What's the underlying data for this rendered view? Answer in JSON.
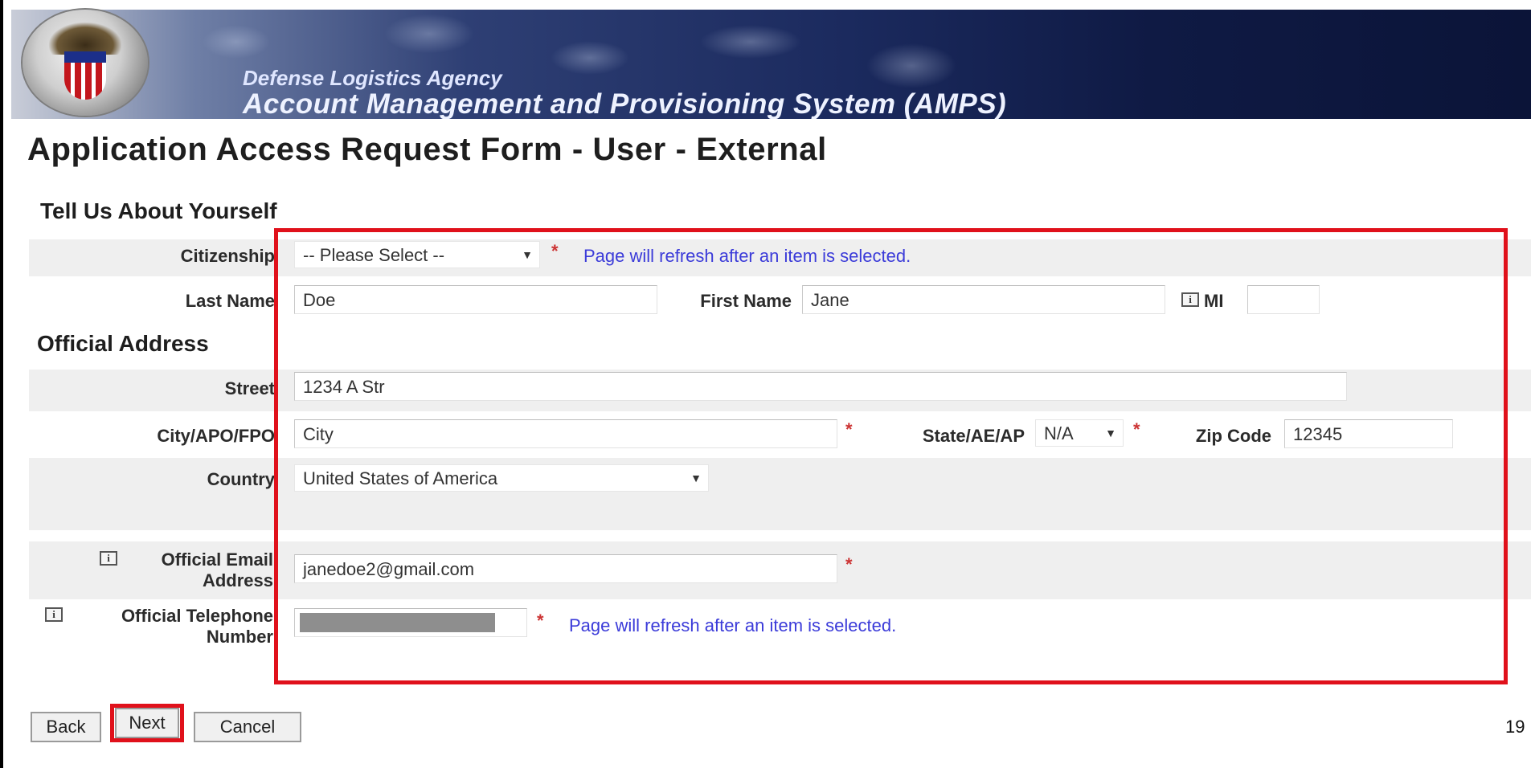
{
  "header": {
    "agency": "Defense Logistics Agency",
    "system": "Account Management and Provisioning System (AMPS)"
  },
  "page_title": "Application Access Request Form - User - External",
  "sections": {
    "about": "Tell Us About Yourself",
    "address": "Official Address"
  },
  "form": {
    "citizenship": {
      "label": "Citizenship",
      "value": "-- Please Select --",
      "note": "Page will refresh after an item is selected."
    },
    "last_name": {
      "label": "Last Name",
      "value": "Doe"
    },
    "first_name": {
      "label": "First Name",
      "value": "Jane"
    },
    "mi": {
      "label": "MI",
      "value": ""
    },
    "street": {
      "label": "Street",
      "value": "1234 A Str"
    },
    "city": {
      "label": "City/APO/FPO",
      "value": "City"
    },
    "state": {
      "label": "State/AE/AP",
      "value": "N/A"
    },
    "zip": {
      "label": "Zip Code",
      "value": "12345"
    },
    "country": {
      "label": "Country",
      "value": "United States of America"
    },
    "email": {
      "label_line1": "Official Email",
      "label_line2": "Address",
      "value": "janedoe2@gmail.com"
    },
    "phone": {
      "label_line1": "Official Telephone",
      "label_line2": "Number",
      "note": "Page will refresh after an item is selected."
    },
    "required_mark": "*",
    "info_glyph": "i"
  },
  "buttons": {
    "back": "Back",
    "next": "Next",
    "cancel": "Cancel"
  },
  "page_number": "19",
  "colors": {
    "header_dark": "#0b1438",
    "annotation_red": "#e0111b",
    "note_blue": "#3b3bd9",
    "required_red": "#cc3333"
  },
  "icons": [
    "dla-seal-logo",
    "info-icon",
    "chevron-down-icon"
  ]
}
